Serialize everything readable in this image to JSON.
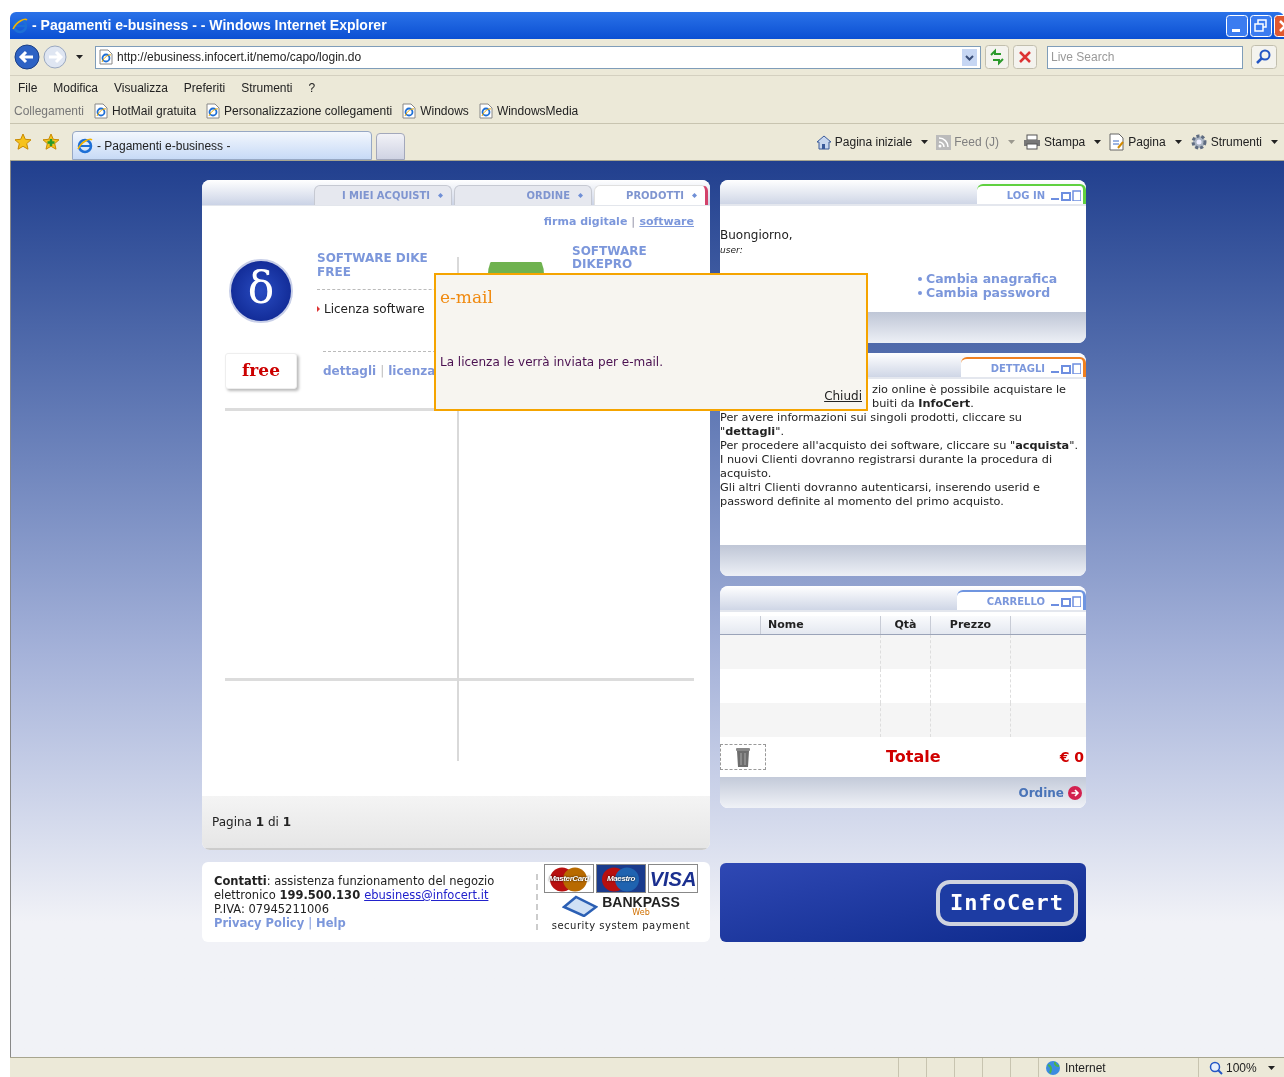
{
  "browser": {
    "title": "- Pagamenti e-business - - Windows Internet Explorer",
    "address": "http://ebusiness.infocert.it/nemo/capo/login.do",
    "search_placeholder": "Live Search",
    "menu": [
      "File",
      "Modifica",
      "Visualizza",
      "Preferiti",
      "Strumenti",
      "?"
    ],
    "links_label": "Collegamenti",
    "links": [
      "HotMail gratuita",
      "Personalizzazione collegamenti",
      "Windows",
      "WindowsMedia"
    ],
    "tab": "- Pagamenti e-business -",
    "commands": [
      {
        "kind": "home",
        "label": "Pagina iniziale",
        "disabled": false
      },
      {
        "kind": "feed",
        "label": "Feed (J)",
        "disabled": true
      },
      {
        "kind": "print",
        "label": "Stampa",
        "disabled": false
      },
      {
        "kind": "page",
        "label": "Pagina",
        "disabled": false
      },
      {
        "kind": "tools",
        "label": "Strumenti",
        "disabled": false
      }
    ],
    "status": {
      "zone": "Internet",
      "zoom": "100%"
    }
  },
  "shop": {
    "tabs": [
      {
        "label": "I MIEI ACQUISTI",
        "selected": false
      },
      {
        "label": "ORDINE",
        "selected": false
      },
      {
        "label": "PRODOTTI",
        "selected": true
      }
    ],
    "separator": "|",
    "subnav": [
      {
        "label": "firma digitale",
        "selected": false
      },
      {
        "label": "software",
        "selected": true
      }
    ],
    "products": [
      {
        "kind": "full",
        "logo_glyph": "δ",
        "title": "SOFTWARE DIKE FREE",
        "item": "Licenza software",
        "badge": "free",
        "actions": [
          "dettagli",
          "licenza"
        ],
        "actions_separator": "|"
      },
      {
        "kind": "covered",
        "title": "SOFTWARE DIKEPRO"
      }
    ],
    "pager": "Pagina **1** di **1**"
  },
  "login": {
    "title": "LOG IN",
    "greeting": "Buongiorno,",
    "user_label": "user:",
    "links": [
      "Cambia anagrafica",
      "Cambia password"
    ]
  },
  "details": {
    "title": "DETTAGLI",
    "covered_lines": [
      "zio online è possibile acquistare le",
      "buiti da **InfoCert**."
    ],
    "paragraphs": [
      "Per avere informazioni sui singoli prodotti, cliccare su \"**dettagli**\".",
      "Per procedere all'acquisto dei software, cliccare su \"**acquista**\".",
      "I nuovi Clienti dovranno registrarsi durante la procedura di acquisto.",
      "Gli altri Clienti dovranno autenticarsi, inserendo userid e password definite al momento del primo acquisto."
    ]
  },
  "cart": {
    "title": "CARRELLO",
    "columns": [
      "Nome",
      "Qtà",
      "Prezzo"
    ],
    "total_label": "Totale",
    "total": "€ 0",
    "order": "Ordine"
  },
  "footer": {
    "contacts": "**Contatti**: assistenza funzionamento del negozio elettronico **199.500.130**",
    "email": "ebusiness@infocert.it",
    "vat": "P.IVA: 07945211006",
    "links": [
      "Privacy Policy",
      "Help"
    ],
    "links_separator": "|",
    "cards": [
      "MasterCard",
      "Maestro",
      "VISA"
    ],
    "bankpass": "BANKPASS",
    "bankpass_sub": "Web",
    "payment_note": "security system payment",
    "brand": "InfoCert"
  },
  "popup": {
    "title": "e-mail",
    "message": "La licenza le verrà inviata per e-mail.",
    "close": "Chiudi"
  }
}
